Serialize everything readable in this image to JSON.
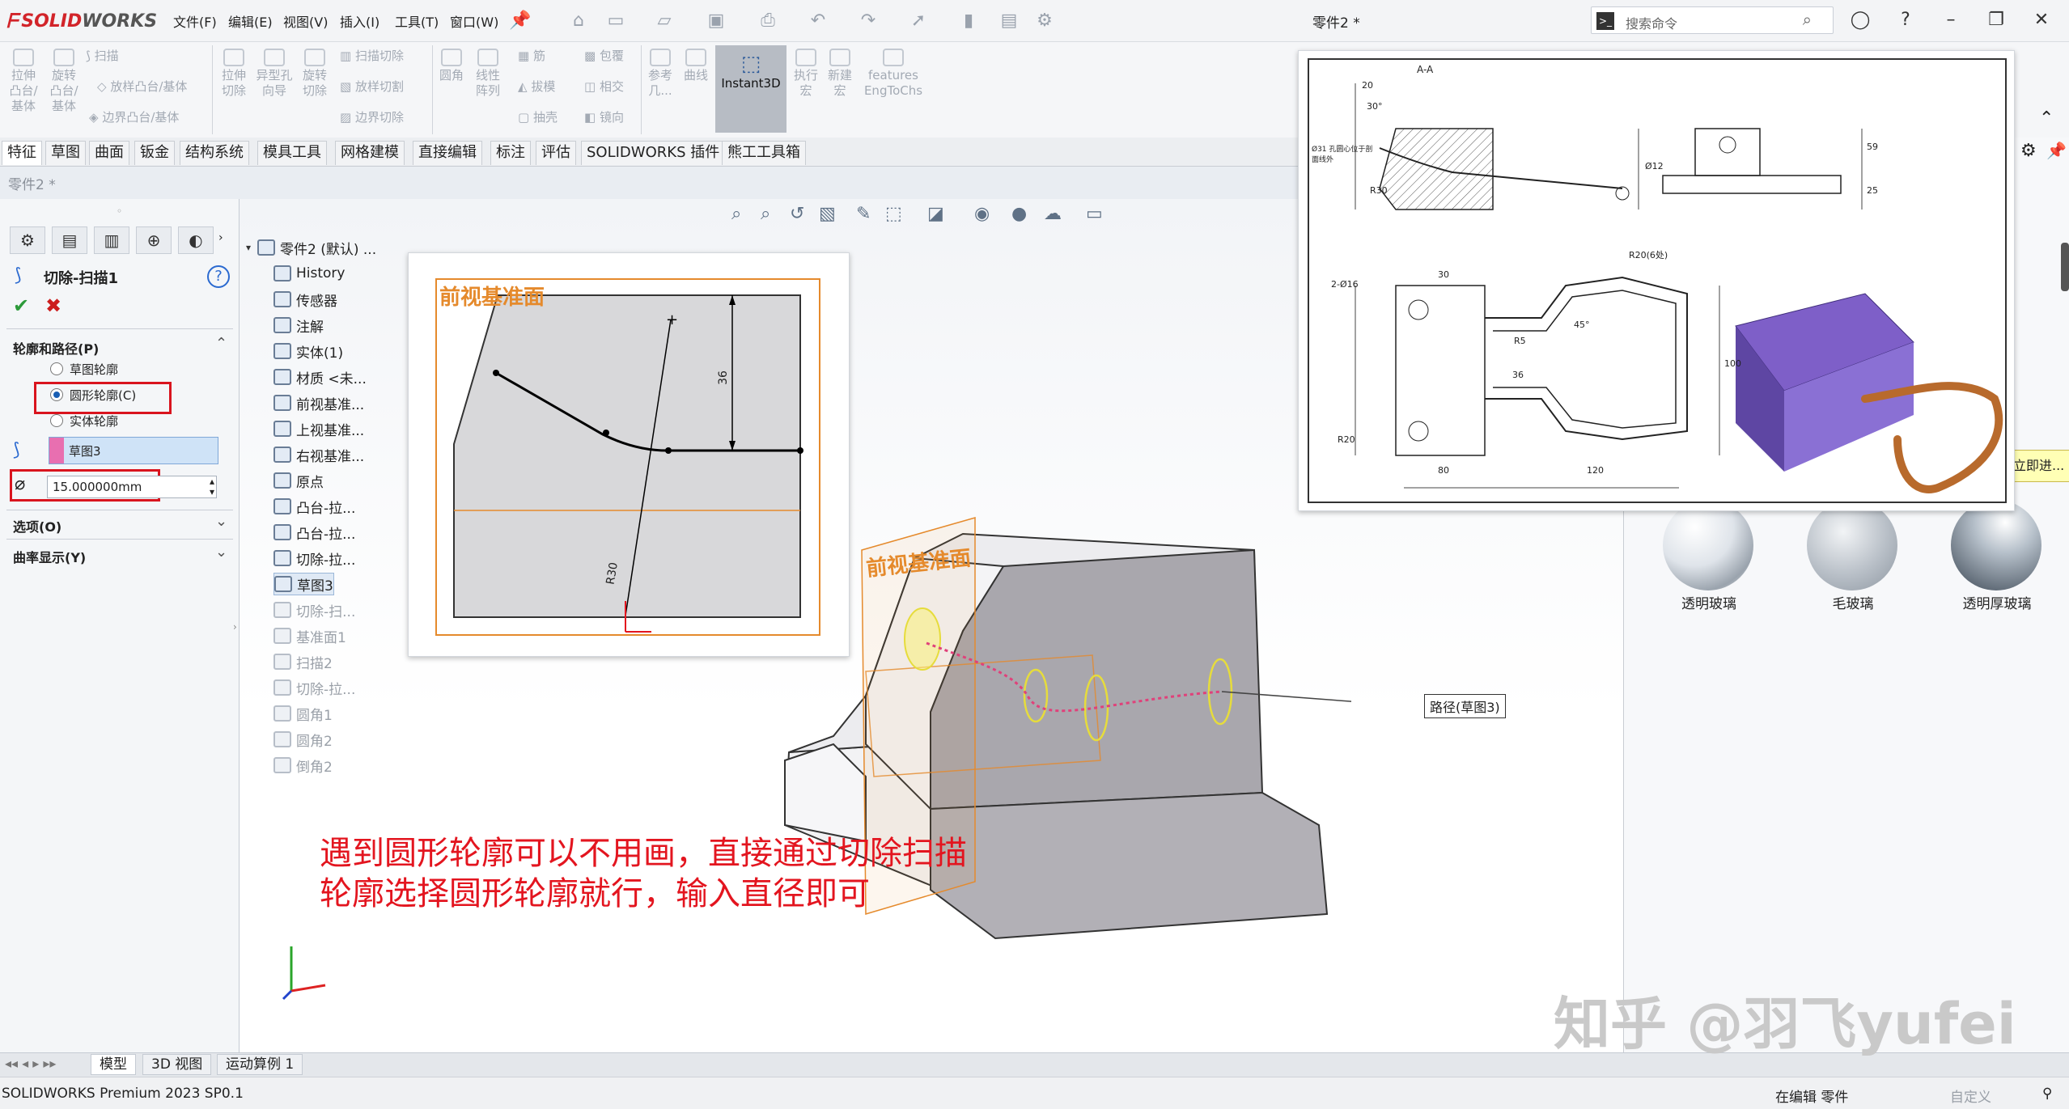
{
  "titlebar": {
    "brand_solid": "SOLID",
    "brand_works": "WORKS",
    "menus": [
      "文件(F)",
      "编辑(E)",
      "视图(V)",
      "插入(I)",
      "工具(T)",
      "窗口(W)"
    ],
    "document": "零件2 *",
    "search_placeholder": "搜索命令"
  },
  "ribbon": {
    "features": [
      "拉伸\n凸台/\n基体",
      "旋转\n凸台/\n基体",
      "扫描",
      "放样凸台/基体",
      "边界凸台/基体",
      "拉伸\n切除",
      "异型孔\n向导",
      "旋转\n切除",
      "扫描切除",
      "放样切割",
      "边界切除",
      "圆角",
      "线性\n阵列",
      "筋",
      "拔模",
      "抽壳",
      "包覆",
      "相交",
      "镜向",
      "参考\n几...",
      "曲线",
      "Instant3D",
      "执行\n宏",
      "新建\n宏",
      "features\nEngToChs"
    ],
    "tabs": [
      "特征",
      "草图",
      "曲面",
      "钣金",
      "结构系统",
      "模具工具",
      "网格建模",
      "直接编辑",
      "标注",
      "评估",
      "SOLIDWORKS 插件",
      "熊工工具箱"
    ]
  },
  "breadcrumb": "零件2 *",
  "property_manager": {
    "title": "切除-扫描1",
    "section_profile": "轮廓和路径(P)",
    "radio_options": [
      "草图轮廓",
      "圆形轮廓(C)",
      "实体轮廓"
    ],
    "selected_radio": "圆形轮廓(C)",
    "path_selection": "草图3",
    "diameter_value": "15.000000mm",
    "section_options": "选项(O)",
    "section_curvature": "曲率显示(Y)"
  },
  "feature_tree": {
    "root": "零件2 (默认) ...",
    "items": [
      {
        "label": "History",
        "dim": false
      },
      {
        "label": "传感器",
        "dim": false
      },
      {
        "label": "注解",
        "dim": false
      },
      {
        "label": "实体(1)",
        "dim": false
      },
      {
        "label": "材质 <未...",
        "dim": false
      },
      {
        "label": "前视基准...",
        "dim": false
      },
      {
        "label": "上视基准...",
        "dim": false
      },
      {
        "label": "右视基准...",
        "dim": false
      },
      {
        "label": "原点",
        "dim": false
      },
      {
        "label": "凸台-拉...",
        "dim": false
      },
      {
        "label": "凸台-拉...",
        "dim": false
      },
      {
        "label": "切除-拉...",
        "dim": false
      },
      {
        "label": "草图3",
        "dim": false
      },
      {
        "label": "切除-扫...",
        "dim": true
      },
      {
        "label": "基准面1",
        "dim": true
      },
      {
        "label": "扫描2",
        "dim": true
      },
      {
        "label": "切除-拉...",
        "dim": true
      },
      {
        "label": "圆角1",
        "dim": true
      },
      {
        "label": "圆角2",
        "dim": true
      },
      {
        "label": "倒角2",
        "dim": true
      }
    ]
  },
  "viewport": {
    "sketch_plane_label": "前视基准面",
    "plane_label_3d": "前视基准面",
    "dim_36": "36",
    "dim_r30": "R30",
    "path_callout": "路径(草图3)",
    "annotation_line1": "遇到圆形轮廓可以不用画，直接通过切除扫描",
    "annotation_line2": "轮廓选择圆形轮廓就行，输入直径即可"
  },
  "drawing": {
    "section_label": "A-A",
    "dims": [
      "20",
      "30°",
      "Ø12",
      "R30",
      "Ø31 孔圆心位于剖面线外",
      "30",
      "R20(6处)",
      "2-Ø16",
      "45°",
      "R5",
      "120",
      "80",
      "100",
      "R20",
      "59",
      "25",
      "36"
    ]
  },
  "right_panel": {
    "callout": "立即进...",
    "materials": [
      "透明玻璃",
      "毛玻璃",
      "透明厚玻璃"
    ]
  },
  "bottom_tabs": [
    "模型",
    "3D 视图",
    "运动算例 1"
  ],
  "status": {
    "version": "SOLIDWORKS Premium 2023 SP0.1",
    "mode": "在编辑 零件",
    "custom": "自定义"
  },
  "watermark": "知乎 @羽飞yufei",
  "colors": {
    "accent": "#d2242a",
    "highlight_box": "#d9141e",
    "annotation": "#e3151f",
    "plane": "#e58a2c",
    "path": "#e0417a",
    "selection": "#cfe3f7"
  }
}
